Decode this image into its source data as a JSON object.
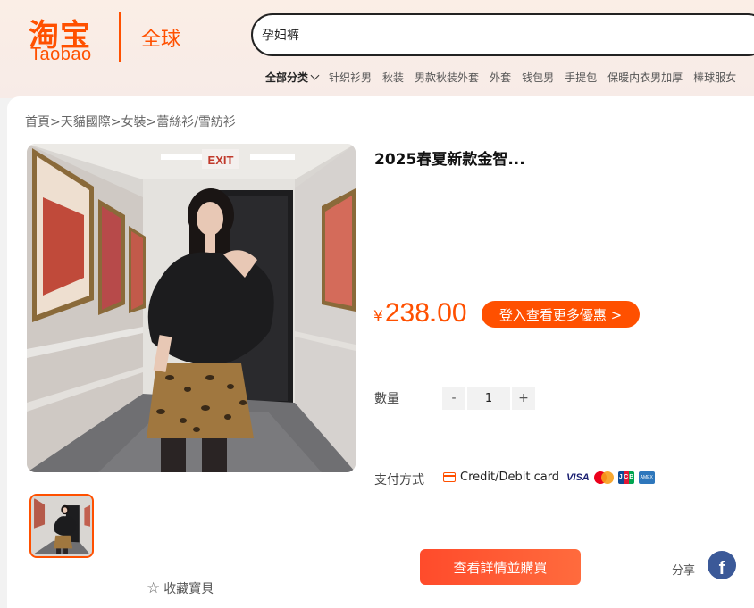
{
  "header": {
    "logo_cn": "淘宝",
    "logo_en": "Taobao",
    "region": "全球"
  },
  "search": {
    "value": "孕妇裤"
  },
  "category_nav": {
    "all_label": "全部分类",
    "items": [
      "针织衫男",
      "秋装",
      "男款秋装外套",
      "外套",
      "钱包男",
      "手提包",
      "保暖内衣男加厚",
      "棒球服女"
    ]
  },
  "breadcrumb": {
    "items": [
      "首頁",
      "天貓國際",
      "女裝",
      "蕾絲衫/雪紡衫"
    ],
    "separator": ">"
  },
  "product": {
    "title": "2025春夏新款金智...",
    "currency_symbol": "¥",
    "price": "238.00",
    "promo_label": "登入查看更多優惠 >",
    "quantity_label": "數量",
    "quantity": "1",
    "minus_label": "-",
    "plus_label": "+",
    "payment_label": "支付方式",
    "payment_method": "Credit/Debit card",
    "buy_label": "查看詳情並購買",
    "share_label": "分享",
    "favorite_label": "收藏寶貝"
  },
  "colors": {
    "brand": "#ff5000",
    "facebook": "#3b5998"
  }
}
